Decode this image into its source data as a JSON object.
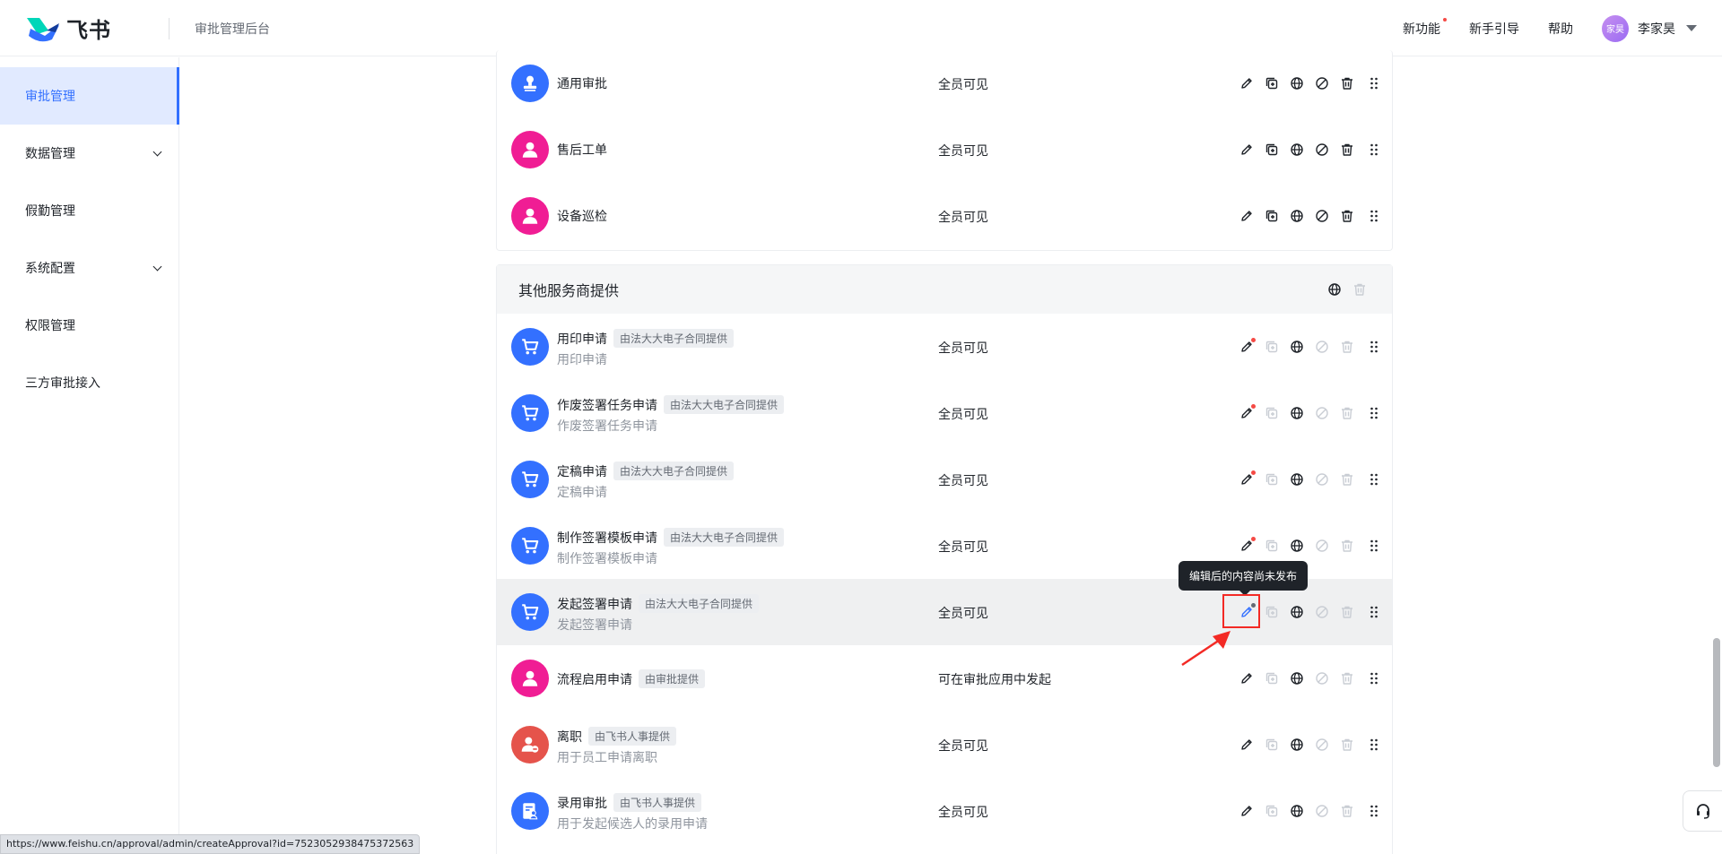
{
  "header": {
    "logo_text": "飞书",
    "subtitle": "审批管理后台",
    "links": [
      {
        "label": "新功能",
        "has_dot": true
      },
      {
        "label": "新手引导",
        "has_dot": false
      },
      {
        "label": "帮助",
        "has_dot": false
      }
    ],
    "avatar_text": "家昊",
    "user_name": "李家昊"
  },
  "sidebar": {
    "items": [
      {
        "label": "审批管理",
        "active": true,
        "expandable": false
      },
      {
        "label": "数据管理",
        "active": false,
        "expandable": true
      },
      {
        "label": "假勤管理",
        "active": false,
        "expandable": false
      },
      {
        "label": "系统配置",
        "active": false,
        "expandable": true
      },
      {
        "label": "权限管理",
        "active": false,
        "expandable": false
      },
      {
        "label": "三方审批接入",
        "active": false,
        "expandable": false
      }
    ]
  },
  "top_group": {
    "rows": [
      {
        "title": "通用审批",
        "visibility": "全员可见",
        "icon": "stamp-icon",
        "color": "blue"
      },
      {
        "title": "售后工单",
        "visibility": "全员可见",
        "icon": "person-icon",
        "color": "pink"
      },
      {
        "title": "设备巡检",
        "visibility": "全员可见",
        "icon": "person-icon",
        "color": "pink"
      }
    ]
  },
  "other_group": {
    "title": "其他服务商提供",
    "rows": [
      {
        "title": "用印申请",
        "tag": "由法大大电子合同提供",
        "desc": "用印申请",
        "visibility": "全员可见",
        "icon": "cart-icon",
        "color": "blue",
        "edit_dot": true
      },
      {
        "title": "作废签署任务申请",
        "tag": "由法大大电子合同提供",
        "desc": "作废签署任务申请",
        "visibility": "全员可见",
        "icon": "cart-icon",
        "color": "blue",
        "edit_dot": true
      },
      {
        "title": "定稿申请",
        "tag": "由法大大电子合同提供",
        "desc": "定稿申请",
        "visibility": "全员可见",
        "icon": "cart-icon",
        "color": "blue",
        "edit_dot": true
      },
      {
        "title": "制作签署模板申请",
        "tag": "由法大大电子合同提供",
        "desc": "制作签署模板申请",
        "visibility": "全员可见",
        "icon": "cart-icon",
        "color": "blue",
        "edit_dot": true
      },
      {
        "title": "发起签署申请",
        "tag": "由法大大电子合同提供",
        "desc": "发起签署申请",
        "visibility": "全员可见",
        "icon": "cart-icon",
        "color": "blue",
        "edit_dot": true
      },
      {
        "title": "流程启用申请",
        "tag": "由审批提供",
        "desc": "",
        "visibility": "可在审批应用中发起",
        "icon": "person-icon",
        "color": "pink",
        "edit_dot": false
      },
      {
        "title": "离职",
        "tag": "由飞书人事提供",
        "desc": "用于员工申请离职",
        "visibility": "全员可见",
        "icon": "person-minus-icon",
        "color": "red",
        "edit_dot": false
      },
      {
        "title": "录用审批",
        "tag": "由飞书人事提供",
        "desc": "用于发起候选人的录用申请",
        "visibility": "全员可见",
        "icon": "doc-person-icon",
        "color": "blue",
        "edit_dot": false
      }
    ]
  },
  "tooltip": {
    "text": "编辑后的内容尚未发布"
  },
  "status_url": "https://www.feishu.cn/approval/admin/createApproval?id=7523052938475372563",
  "colors": {
    "accent": "#3370ff",
    "pink": "#f01d94",
    "red_dot": "#f54a45",
    "highlight": "#f32a25"
  }
}
